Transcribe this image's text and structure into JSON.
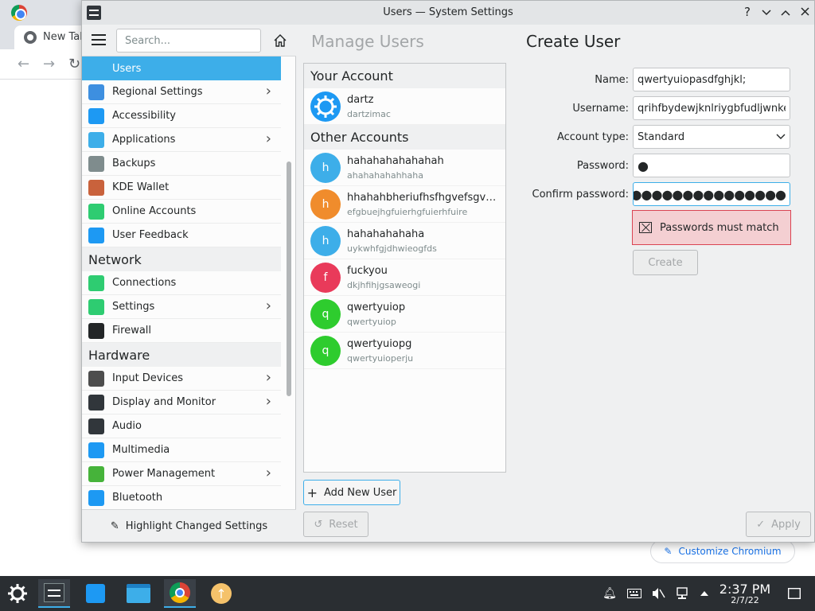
{
  "chromium": {
    "tab_label": "New Tab",
    "customize_label": "Customize Chromium"
  },
  "window": {
    "title": "Users — System Settings",
    "help": "?",
    "minimize": "⌄",
    "maximize": "⌃",
    "close": "✕"
  },
  "sidebar": {
    "search_placeholder": "Search...",
    "items_top": [
      {
        "label": "Users",
        "icon": "users-icon",
        "color": "#3daee9",
        "chevron": false,
        "active": true
      },
      {
        "label": "Regional Settings",
        "icon": "regional-settings-icon",
        "color": "#3d8fe0",
        "chevron": true
      },
      {
        "label": "Accessibility",
        "icon": "accessibility-icon",
        "color": "#1d99f3",
        "chevron": false
      },
      {
        "label": "Applications",
        "icon": "applications-icon",
        "color": "#3daee9",
        "chevron": true
      },
      {
        "label": "Backups",
        "icon": "backups-icon",
        "color": "#7f8c8d",
        "chevron": false
      },
      {
        "label": "KDE Wallet",
        "icon": "kde-wallet-icon",
        "color": "#c9623c",
        "chevron": false
      },
      {
        "label": "Online Accounts",
        "icon": "online-accounts-icon",
        "color": "#2ecc71",
        "chevron": false
      },
      {
        "label": "User Feedback",
        "icon": "user-feedback-icon",
        "color": "#1d99f3",
        "chevron": false
      }
    ],
    "network_label": "Network",
    "items_network": [
      {
        "label": "Connections",
        "icon": "connections-icon",
        "color": "#2ecc71",
        "chevron": false
      },
      {
        "label": "Settings",
        "icon": "network-settings-icon",
        "color": "#2ecc71",
        "chevron": true
      },
      {
        "label": "Firewall",
        "icon": "firewall-icon",
        "color": "#232627",
        "chevron": false
      }
    ],
    "hardware_label": "Hardware",
    "items_hardware": [
      {
        "label": "Input Devices",
        "icon": "input-devices-icon",
        "color": "#4d4d4d",
        "chevron": true
      },
      {
        "label": "Display and Monitor",
        "icon": "display-monitor-icon",
        "color": "#31363b",
        "chevron": true
      },
      {
        "label": "Audio",
        "icon": "audio-icon",
        "color": "#31363b",
        "chevron": false
      },
      {
        "label": "Multimedia",
        "icon": "multimedia-icon",
        "color": "#1d99f3",
        "chevron": false
      },
      {
        "label": "Power Management",
        "icon": "power-management-icon",
        "color": "#46b33a",
        "chevron": true
      },
      {
        "label": "Bluetooth",
        "icon": "bluetooth-icon",
        "color": "#1d99f3",
        "chevron": false
      }
    ],
    "footer_label": "Highlight Changed Settings"
  },
  "content": {
    "breadcrumb_prev": "Manage Users",
    "breadcrumb_current": "Create User",
    "your_account_header": "Your Account",
    "your_account": {
      "name": "dartz",
      "sub": "dartzimac"
    },
    "other_accounts_header": "Other Accounts",
    "other_accounts": [
      {
        "initial": "h",
        "name": "hahahahahahahah",
        "sub": "ahahahahahhaha",
        "color": "#3daee9"
      },
      {
        "initial": "h",
        "name": "hhahahbheriufhsfhgvefsgvehsbhxfjvhb",
        "sub": "efgbuejhgfuierhgfuierhfuire",
        "color": "#f08c2c"
      },
      {
        "initial": "h",
        "name": "hahahahahaha",
        "sub": "uykwhfgjdhwieogfds",
        "color": "#3daee9"
      },
      {
        "initial": "f",
        "name": "fuckyou",
        "sub": "dkjhfihjgsaweogi",
        "color": "#e93a5a"
      },
      {
        "initial": "q",
        "name": "qwertyuiop",
        "sub": "qwertyuiop",
        "color": "#2ecc2e"
      },
      {
        "initial": "q",
        "name": "qwertyuiopg",
        "sub": "qwertyuioperju",
        "color": "#2ecc2e"
      }
    ],
    "add_user_label": "Add New User",
    "reset_label": "Reset",
    "apply_label": "Apply"
  },
  "form": {
    "name_label": "Name:",
    "name_value": "qwertyuiopasdfghjkl;",
    "username_label": "Username:",
    "username_value": "qrihfbydewjknlriygbfudljwnkeo",
    "account_type_label": "Account type:",
    "account_type_value": "Standard",
    "password_label": "Password:",
    "password_dots": "●",
    "confirm_label": "Confirm password:",
    "confirm_dots": "●●●●●●●●●●●●●●●●●",
    "error_text": "Passwords must match",
    "create_label": "Create"
  },
  "taskbar": {
    "time": "2:37 PM",
    "date": "2/7/22"
  }
}
